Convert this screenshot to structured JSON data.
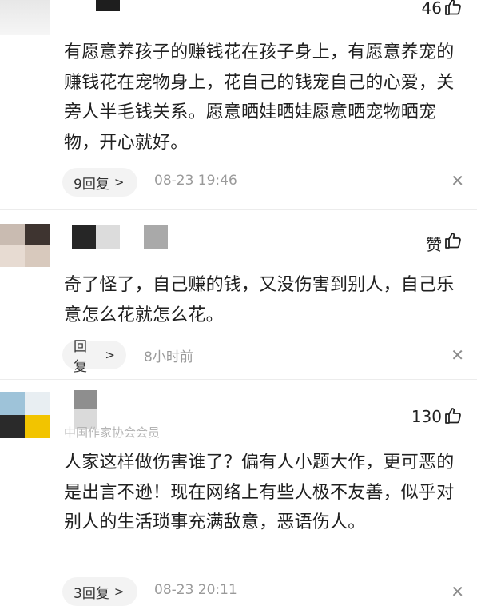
{
  "comments": [
    {
      "likes": "46",
      "text": "有愿意养孩子的赚钱花在孩子身上，有愿意养宠的赚钱花在宠物身上，花自己的钱宠自己的心爱，关旁人半毛钱关系。愿意晒娃晒娃愿意晒宠物晒宠物，开心就好。",
      "reply_label": "9回复",
      "time": "08-23 19:46"
    },
    {
      "likes": "赞",
      "text": "奇了怪了，自己赚的钱，又没伤害到别人，自己乐意怎么花就怎么花。",
      "reply_label": "回复",
      "time": "8小时前"
    },
    {
      "likes": "130",
      "badge": "中国作家协会会员",
      "text": "人家这样做伤害谁了？偏有人小题大作，更可恶的是出言不逊！现在网络上有些人极不友善，似乎对别人的生活琐事充满敌意，恶语伤人。",
      "reply_label": "3回复",
      "time": "08-23 20:11"
    }
  ],
  "icons": {
    "like": "thumbs-up-icon",
    "close": "close-icon",
    "chevron": "chevron-right-icon"
  },
  "glyphs": {
    "chevron": ">",
    "close": "✕"
  },
  "colors": {
    "pill_bg": "#f3f3f3",
    "muted": "#9a9a9a",
    "text": "#202020"
  }
}
